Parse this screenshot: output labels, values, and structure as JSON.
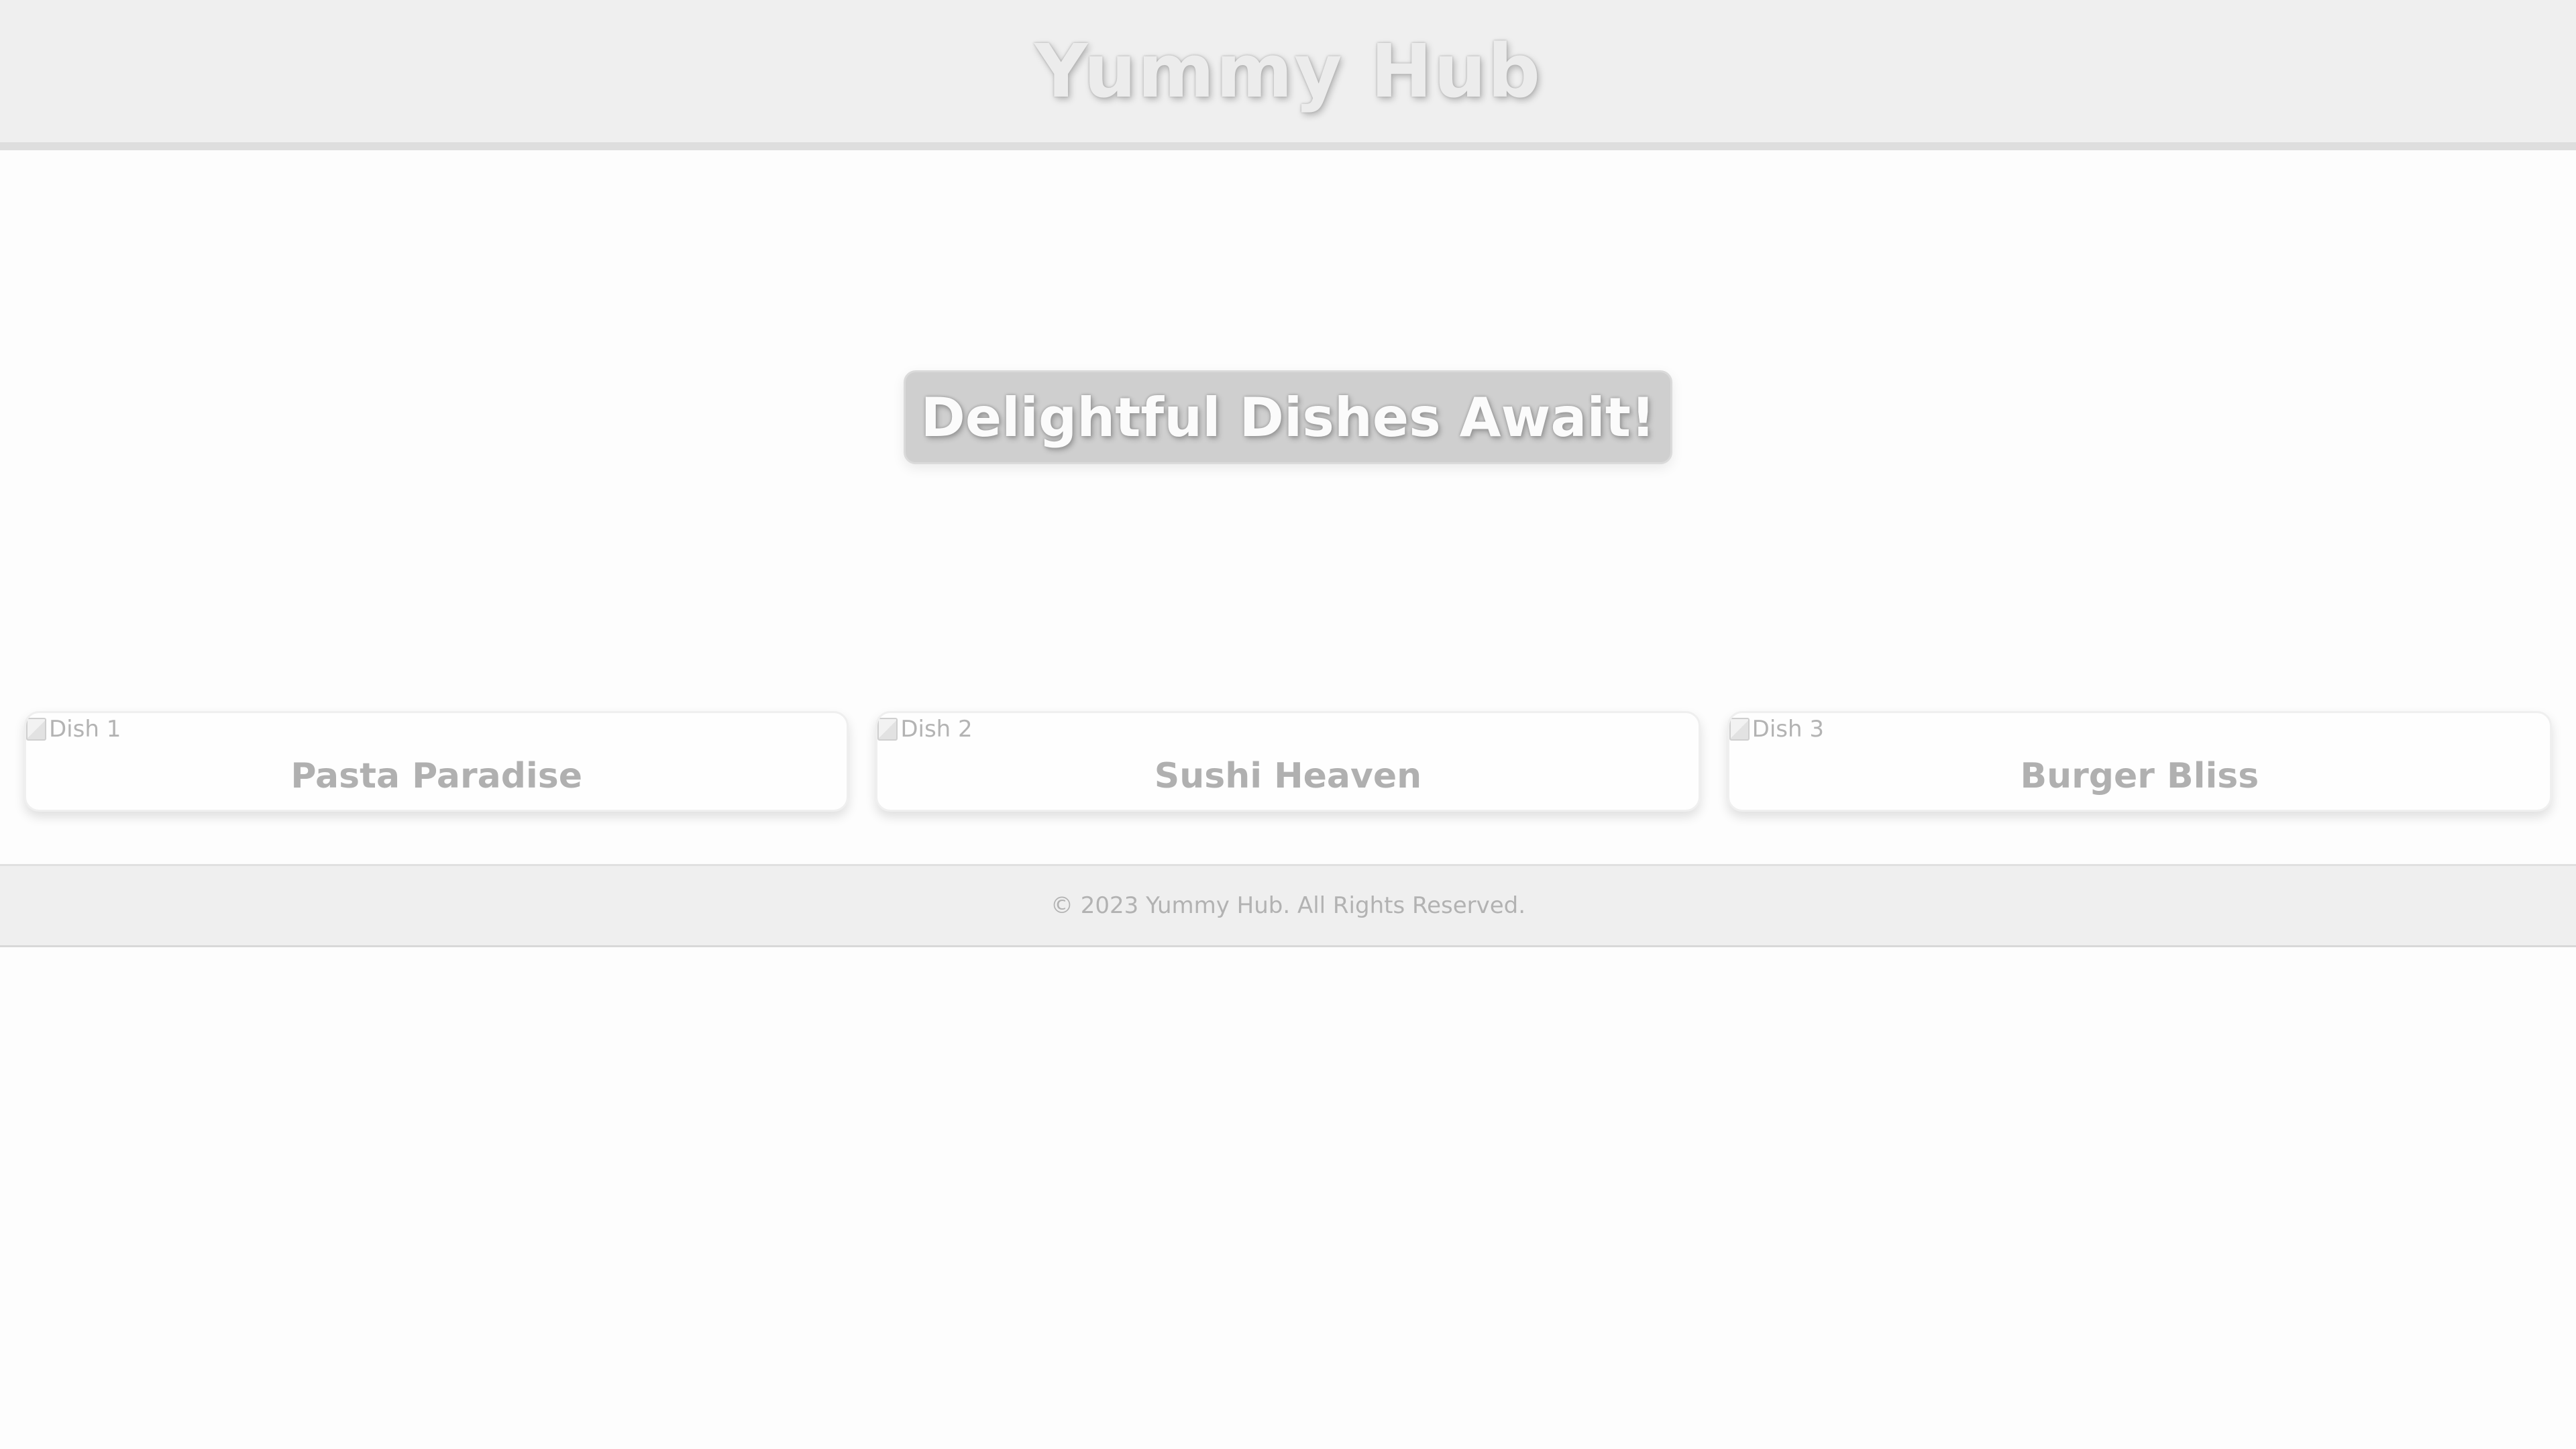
{
  "header": {
    "title": "Yummy Hub"
  },
  "hero": {
    "heading": "Delightful Dishes Await!"
  },
  "dishes": [
    {
      "image_alt": "Dish 1",
      "name": "Pasta Paradise"
    },
    {
      "image_alt": "Dish 2",
      "name": "Sushi Heaven"
    },
    {
      "image_alt": "Dish 3",
      "name": "Burger Bliss"
    }
  ],
  "footer": {
    "text": "© 2023 Yummy Hub. All Rights Reserved."
  },
  "colors": {
    "header_bg": "#efefef",
    "hero_banner_bg": "#cfcfcf",
    "page_bg": "#fdfdfd",
    "text_muted": "#b0b0b0"
  },
  "icons": {
    "dish_image": "broken-image-icon"
  }
}
